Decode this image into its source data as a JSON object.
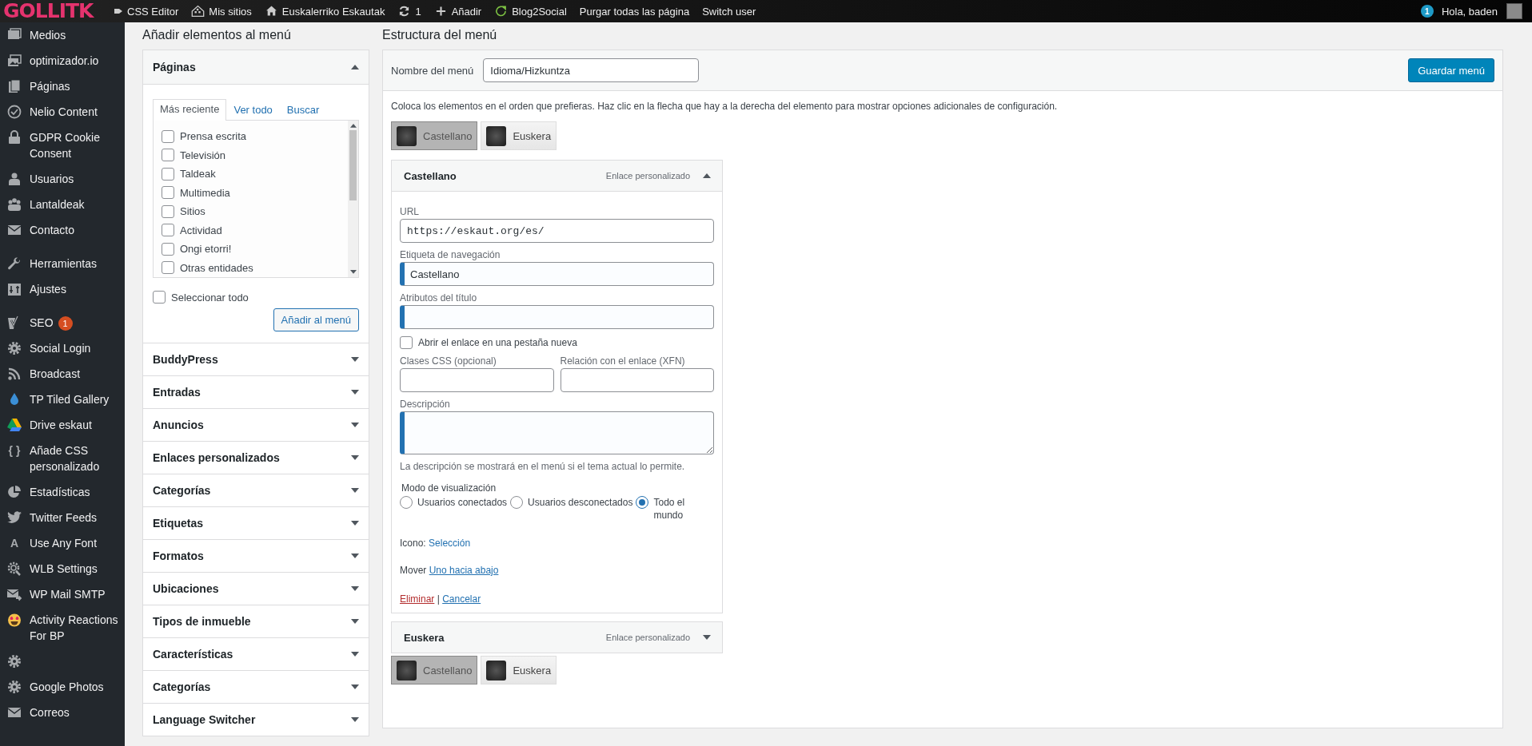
{
  "admin_bar": {
    "logo": "GOLLITK",
    "items": [
      {
        "kind": "flag",
        "label": "CSS Editor"
      },
      {
        "kind": "sites",
        "label": "Mis sitios"
      },
      {
        "kind": "home",
        "label": "Euskalerriko Eskautak"
      },
      {
        "kind": "refresh",
        "label": "1"
      },
      {
        "kind": "plus",
        "label": "Añadir"
      },
      {
        "kind": "leaf",
        "label": "Blog2Social"
      },
      {
        "kind": "none",
        "label": "Purgar todas las página"
      },
      {
        "kind": "none",
        "label": "Switch user"
      }
    ],
    "notifications": "1",
    "greeting": "Hola, baden"
  },
  "sidebar": {
    "sections": [
      {
        "items": [
          {
            "kind": "media",
            "label": "Medios"
          },
          {
            "kind": "images",
            "label": "optimizador.io"
          },
          {
            "kind": "pages",
            "label": "Páginas"
          },
          {
            "kind": "clock",
            "label": "Nelio Content"
          },
          {
            "kind": "lock",
            "label": "GDPR Cookie Consent"
          },
          {
            "kind": "user",
            "label": "Usuarios"
          },
          {
            "kind": "group",
            "label": "Lantaldeak"
          },
          {
            "kind": "mail",
            "label": "Contacto"
          }
        ]
      },
      {
        "items": [
          {
            "kind": "wrench",
            "label": "Herramientas"
          },
          {
            "kind": "sliders",
            "label": "Ajustes"
          }
        ]
      },
      {
        "items": [
          {
            "kind": "seo",
            "label": "SEO",
            "badge": "1"
          },
          {
            "kind": "gear",
            "label": "Social Login"
          },
          {
            "kind": "rss",
            "label": "Broadcast"
          },
          {
            "kind": "drop",
            "label": "TP Tiled Gallery"
          },
          {
            "kind": "drive",
            "label": "Drive eskaut"
          },
          {
            "kind": "glyph",
            "glyph": "{ }",
            "label": "Añade CSS personalizado"
          },
          {
            "kind": "pie",
            "label": "Estadísticas"
          },
          {
            "kind": "bird",
            "label": "Twitter Feeds"
          },
          {
            "kind": "glyph",
            "glyph": "A",
            "label": "Use Any Font"
          },
          {
            "kind": "gears",
            "label": "WLB Settings"
          },
          {
            "kind": "mailarrow",
            "label": "WP Mail SMTP"
          },
          {
            "kind": "emoji",
            "label": "Activity Reactions For BP"
          },
          {
            "kind": "gear"
          },
          {
            "kind": "gear",
            "label": "Google Photos"
          },
          {
            "kind": "mail",
            "label": "Correos"
          }
        ]
      }
    ]
  },
  "left_panel": {
    "heading": "Añadir elementos al menú",
    "pages": {
      "title": "Páginas",
      "expanded": true,
      "tabs": [
        {
          "label": "Más reciente",
          "selected": true
        },
        {
          "label": "Ver todo",
          "selected": false
        },
        {
          "label": "Buscar",
          "selected": false
        }
      ],
      "items": [
        {
          "label": "Prensa escrita",
          "checked": false
        },
        {
          "label": "Televisión",
          "checked": false
        },
        {
          "label": "Taldeak",
          "checked": false
        },
        {
          "label": "Multimedia",
          "checked": false
        },
        {
          "label": "Sitios",
          "checked": false
        },
        {
          "label": "Actividad",
          "checked": false
        },
        {
          "label": "Ongi etorri!",
          "checked": false
        },
        {
          "label": "Otras entidades",
          "checked": false
        }
      ],
      "select_all": {
        "label": "Seleccionar todo",
        "checked": false
      },
      "add_button": "Añadir al menú"
    },
    "sections": [
      {
        "title": "BuddyPress",
        "expanded": false
      },
      {
        "title": "Entradas",
        "expanded": false
      },
      {
        "title": "Anuncios",
        "expanded": false
      },
      {
        "title": "Enlaces personalizados",
        "expanded": false
      },
      {
        "title": "Categorías",
        "expanded": false
      },
      {
        "title": "Etiquetas",
        "expanded": false
      },
      {
        "title": "Formatos",
        "expanded": false
      },
      {
        "title": "Ubicaciones",
        "expanded": false
      },
      {
        "title": "Tipos de inmueble",
        "expanded": false
      },
      {
        "title": "Características",
        "expanded": false
      },
      {
        "title": "Categorías",
        "expanded": false
      },
      {
        "title": "Language Switcher",
        "expanded": false
      }
    ]
  },
  "right_panel": {
    "heading": "Estructura del menú",
    "menu_name_label": "Nombre del menú",
    "menu_name": "Idioma/Hizkuntza",
    "save_button": "Guardar menú",
    "instructions": "Coloca los elementos en el orden que prefieras. Haz clic en la flecha que hay a la derecha del elemento para mostrar opciones adicionales de configuración.",
    "chips_top": [
      {
        "label": "Castellano",
        "selected": true
      },
      {
        "label": "Euskera",
        "selected": false
      }
    ],
    "items": [
      {
        "title": "Castellano",
        "type": "Enlace personalizado",
        "expanded": true,
        "fields": [
          {
            "kind": "mono",
            "label": "URL",
            "value": "https://eskaut.org/es/",
            "highlighted": false
          },
          {
            "kind": "text",
            "label": "Etiqueta de navegación",
            "value": "Castellano",
            "highlighted": true
          },
          {
            "kind": "text",
            "label": "Atributos del título",
            "highlighted": true
          },
          {
            "kind": "checkbox",
            "label": "Abrir el enlace en una pestaña nueva",
            "checked": false
          },
          {
            "kind": "pair",
            "fields": [
              {
                "label": "Clases CSS (opcional)",
                "highlighted": false
              },
              {
                "label": "Relación con el enlace (XFN)",
                "highlighted": false
              }
            ]
          },
          {
            "kind": "textarea",
            "label": "Descripción",
            "highlighted": true,
            "hint": "La descripción se mostrará en el menú si el tema actual lo permite."
          }
        ],
        "visibility_label": "Modo de visualización",
        "visibility_options": [
          {
            "label": "Usuarios conectados",
            "selected": false
          },
          {
            "label": "Usuarios desconectados",
            "selected": false
          },
          {
            "label": "Todo el mundo",
            "selected": true
          }
        ],
        "icon_label": "Icono:",
        "icon_link": "Selección",
        "move_label": "Mover",
        "move_link": "Uno hacia abajo",
        "remove": "Eliminar",
        "separator": "|",
        "cancel": "Cancelar"
      },
      {
        "title": "Euskera",
        "type": "Enlace personalizado",
        "expanded": false
      }
    ],
    "chips_bottom": [
      {
        "label": "Castellano",
        "selected": true
      },
      {
        "label": "Euskera",
        "selected": false
      }
    ]
  }
}
